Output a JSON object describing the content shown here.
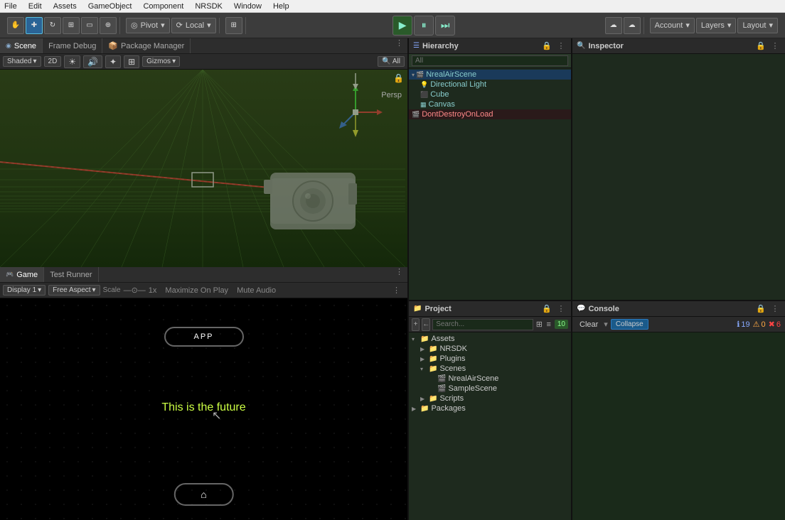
{
  "menubar": {
    "items": [
      "File",
      "Edit",
      "Assets",
      "GameObject",
      "Component",
      "NRSDK",
      "Window",
      "Help"
    ]
  },
  "toolbar": {
    "tools": [
      "hand",
      "move",
      "rotate",
      "scale",
      "rect",
      "transform"
    ],
    "pivot_label": "Pivot",
    "local_label": "Local",
    "play_label": "▶",
    "pause_label": "⏸",
    "step_label": "⏭",
    "cloud_icon": "☁",
    "account_label": "Account",
    "layers_label": "Layers",
    "layout_label": "Layout"
  },
  "scene_tab": {
    "tabs": [
      {
        "label": "Scene",
        "icon": "◉",
        "active": true
      },
      {
        "label": "Frame Debug",
        "icon": "",
        "active": false
      },
      {
        "label": "Package Manager",
        "icon": "",
        "active": false
      }
    ],
    "scene_controls": {
      "shading": "Shaded",
      "perspective": "2D",
      "lighting": "",
      "audio": "",
      "effects": "",
      "gizmos": "Gizmos",
      "search": "All"
    },
    "persp_label": "Persp"
  },
  "game_tab": {
    "tabs": [
      {
        "label": "Game",
        "icon": "🎮",
        "active": true
      },
      {
        "label": "Test Runner",
        "icon": "",
        "active": false
      }
    ],
    "controls": {
      "display": "Display 1",
      "aspect": "Free Aspect",
      "scale": "Scale",
      "scale_value": "1x",
      "maximize": "Maximize On Play",
      "mute": "Mute Audio"
    },
    "app_button": "APP",
    "future_text": "This is the future",
    "home_icon": "⌂"
  },
  "hierarchy": {
    "title": "Hierarchy",
    "lock_icon": "🔒",
    "search_placeholder": "All",
    "items": [
      {
        "label": "NrealAirScene",
        "indent": 0,
        "type": "scene",
        "expanded": true,
        "selected": true
      },
      {
        "label": "Directional Light",
        "indent": 1,
        "type": "light"
      },
      {
        "label": "Cube",
        "indent": 1,
        "type": "cube"
      },
      {
        "label": "Canvas",
        "indent": 1,
        "type": "canvas"
      },
      {
        "label": "DontDestroyOnLoad",
        "indent": 0,
        "type": "scene",
        "highlighted": true
      }
    ]
  },
  "inspector": {
    "title": "Inspector",
    "lock_icon": "🔒"
  },
  "project": {
    "title": "Project",
    "lock_icon": "🔒",
    "badge_count": "10",
    "tree": [
      {
        "label": "Assets",
        "indent": 0,
        "type": "folder",
        "expanded": true
      },
      {
        "label": "NRSDK",
        "indent": 1,
        "type": "folder"
      },
      {
        "label": "Plugins",
        "indent": 1,
        "type": "folder"
      },
      {
        "label": "Scenes",
        "indent": 1,
        "type": "folder",
        "expanded": true
      },
      {
        "label": "NrealAirScene",
        "indent": 2,
        "type": "scene"
      },
      {
        "label": "SampleScene",
        "indent": 2,
        "type": "scene"
      },
      {
        "label": "Scripts",
        "indent": 1,
        "type": "folder"
      },
      {
        "label": "Packages",
        "indent": 0,
        "type": "folder"
      }
    ]
  },
  "console": {
    "title": "Console",
    "clear_label": "Clear",
    "collapse_label": "Collapse",
    "info_count": "19",
    "warn_count": "0",
    "error_count": "6"
  }
}
